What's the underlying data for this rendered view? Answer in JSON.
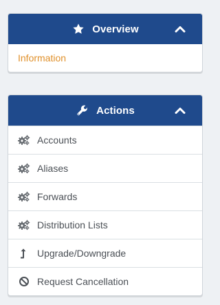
{
  "overview": {
    "title": "Overview",
    "icon": "star-icon",
    "collapse_icon": "chevron-up-icon",
    "links": [
      {
        "label": "Information"
      }
    ]
  },
  "actions": {
    "title": "Actions",
    "icon": "wrench-icon",
    "collapse_icon": "chevron-up-icon",
    "items": [
      {
        "label": "Accounts",
        "icon": "gears-icon"
      },
      {
        "label": "Aliases",
        "icon": "gears-icon"
      },
      {
        "label": "Forwards",
        "icon": "gears-icon"
      },
      {
        "label": "Distribution Lists",
        "icon": "gears-icon"
      },
      {
        "label": "Upgrade/Downgrade",
        "icon": "level-up-icon"
      },
      {
        "label": "Request Cancellation",
        "icon": "ban-icon"
      }
    ]
  },
  "colors": {
    "header_bg": "#1f4a8c",
    "link_accent": "#e0902a",
    "page_bg": "#eef1f4"
  }
}
